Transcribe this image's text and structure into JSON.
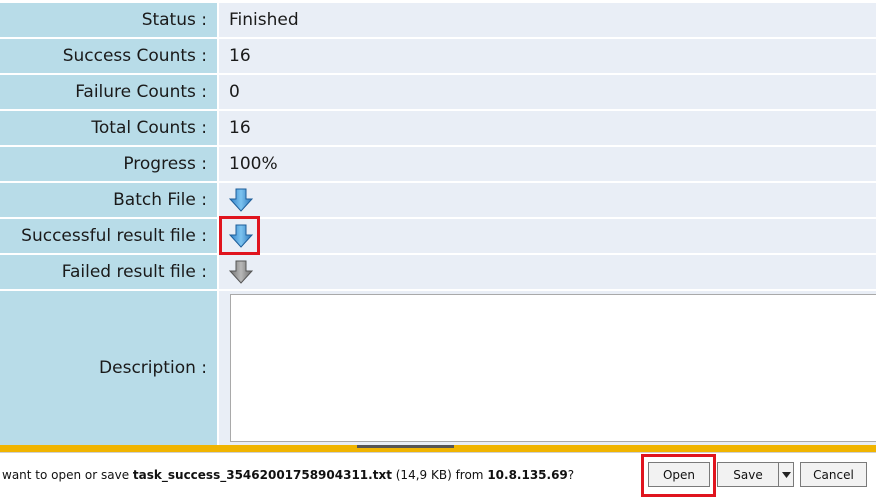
{
  "details": {
    "status": {
      "label": "Status :",
      "value": "Finished"
    },
    "success_counts": {
      "label": "Success Counts :",
      "value": "16"
    },
    "failure_counts": {
      "label": "Failure Counts :",
      "value": "0"
    },
    "total_counts": {
      "label": "Total Counts :",
      "value": "16"
    },
    "progress": {
      "label": "Progress :",
      "value": "100%"
    },
    "batch_file": {
      "label": "Batch File :",
      "icon": "download-arrow-blue-icon"
    },
    "successful_result_file": {
      "label": "Successful result file :",
      "icon": "download-arrow-blue-icon"
    },
    "failed_result_file": {
      "label": "Failed result file :",
      "icon": "download-arrow-gray-icon"
    },
    "description": {
      "label": "Description :",
      "value": ""
    }
  },
  "download_bar": {
    "prefix": "want to open or save ",
    "filename": "task_success_35462001758904311.txt",
    "size": " (14,9 KB) from ",
    "host": "10.8.135.69",
    "suffix": "?",
    "open_label": "Open",
    "save_label": "Save",
    "cancel_label": "Cancel"
  },
  "colors": {
    "label_bg": "#b8dce8",
    "value_bg": "#e9eef6",
    "highlight": "#e0141e",
    "notification_bar": "#f0b400"
  }
}
